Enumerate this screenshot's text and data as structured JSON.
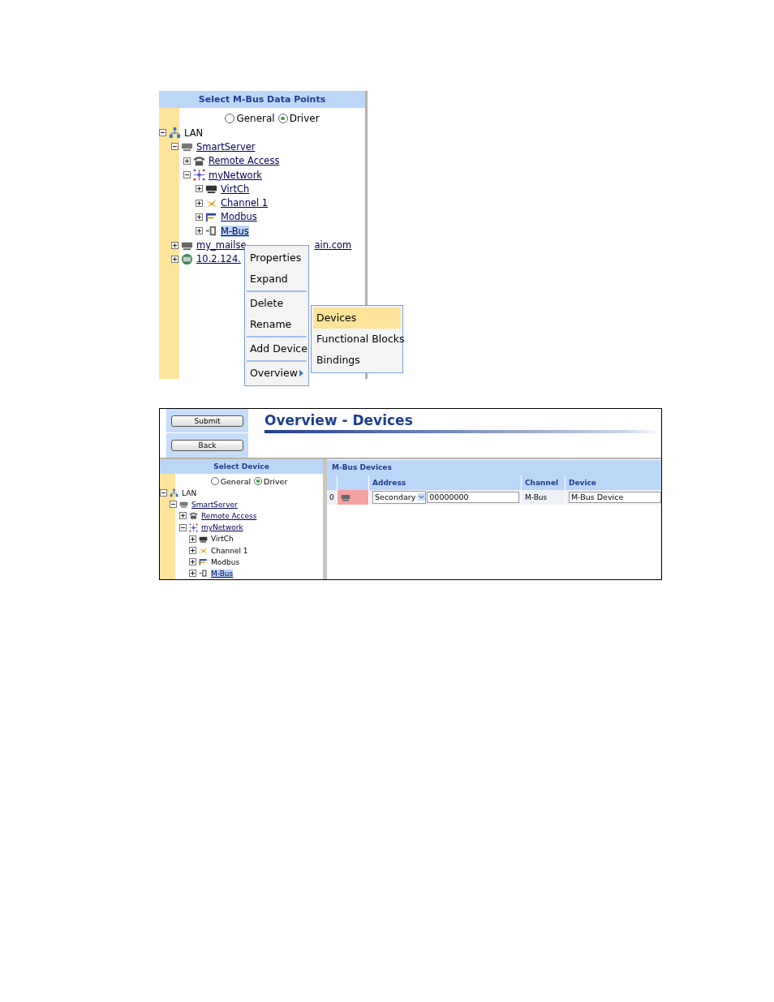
{
  "top_panel": {
    "title": "Select M-Bus Data Points",
    "radios": [
      {
        "label": "General",
        "checked": false
      },
      {
        "label": "Driver",
        "checked": true
      }
    ],
    "tree": [
      {
        "label": "LAN",
        "kind": "lan",
        "link": false,
        "expanded": true,
        "selected": false,
        "children": [
          {
            "label": "SmartServer",
            "kind": "server",
            "link": true,
            "expanded": true,
            "selected": false,
            "children": [
              {
                "label": "Remote Access",
                "kind": "phone",
                "link": true,
                "expanded": false,
                "selected": false
              },
              {
                "label": "myNetwork",
                "kind": "network",
                "link": true,
                "expanded": true,
                "selected": false,
                "children": [
                  {
                    "label": "VirtCh",
                    "kind": "virt",
                    "link": true,
                    "expanded": false,
                    "selected": false
                  },
                  {
                    "label": "Channel 1",
                    "kind": "channel",
                    "link": true,
                    "expanded": false,
                    "selected": false
                  },
                  {
                    "label": "Modbus",
                    "kind": "modbus",
                    "link": true,
                    "expanded": false,
                    "selected": false
                  },
                  {
                    "label": "M-Bus",
                    "kind": "mbus",
                    "link": true,
                    "expanded": false,
                    "selected": true
                  }
                ]
              }
            ]
          },
          {
            "label": "my_mailse",
            "label_tail": "ain.com",
            "kind": "pc",
            "link": true,
            "expanded": false,
            "selected": false
          },
          {
            "label": "10.2.124.",
            "kind": "globe",
            "link": true,
            "expanded": false,
            "selected": false
          }
        ]
      }
    ],
    "context_menu": {
      "groups": [
        [
          "Properties",
          "Expand"
        ],
        [
          "Delete",
          "Rename"
        ],
        [
          "Add Device"
        ],
        [
          "Overview"
        ]
      ],
      "submenu": [
        {
          "label": "Devices",
          "selected": true
        },
        {
          "label": "Functional Blocks",
          "selected": false
        },
        {
          "label": "Bindings",
          "selected": false
        }
      ]
    }
  },
  "bottom_panel": {
    "buttons": [
      "Submit",
      "Back"
    ],
    "title": "Overview - Devices",
    "tree_title": "Select Device",
    "radios": [
      {
        "label": "General",
        "checked": false
      },
      {
        "label": "Driver",
        "checked": true
      }
    ],
    "tree": [
      {
        "label": "LAN",
        "kind": "lan",
        "link": false,
        "expanded": true,
        "selected": false,
        "children": [
          {
            "label": "SmartServer",
            "kind": "server",
            "link": true,
            "expanded": true,
            "selected": false,
            "children": [
              {
                "label": "Remote Access",
                "kind": "phone",
                "link": true,
                "expanded": false,
                "selected": false
              },
              {
                "label": "myNetwork",
                "kind": "network",
                "link": true,
                "expanded": true,
                "selected": false,
                "children": [
                  {
                    "label": "VirtCh",
                    "kind": "virt",
                    "link": false,
                    "expanded": false,
                    "selected": false
                  },
                  {
                    "label": "Channel 1",
                    "kind": "channel",
                    "link": false,
                    "expanded": false,
                    "selected": false
                  },
                  {
                    "label": "Modbus",
                    "kind": "modbus",
                    "link": false,
                    "expanded": false,
                    "selected": false
                  },
                  {
                    "label": "M-Bus",
                    "kind": "mbus",
                    "link": true,
                    "expanded": false,
                    "selected": true
                  }
                ]
              }
            ]
          }
        ]
      }
    ],
    "table": {
      "title": "M-Bus Devices",
      "columns": [
        "Address",
        "Channel",
        "Device"
      ],
      "rows": [
        {
          "index": "0",
          "address_type": "Secondary",
          "address": "00000000",
          "channel": "M-Bus",
          "device": "M-Bus Device"
        }
      ]
    }
  }
}
